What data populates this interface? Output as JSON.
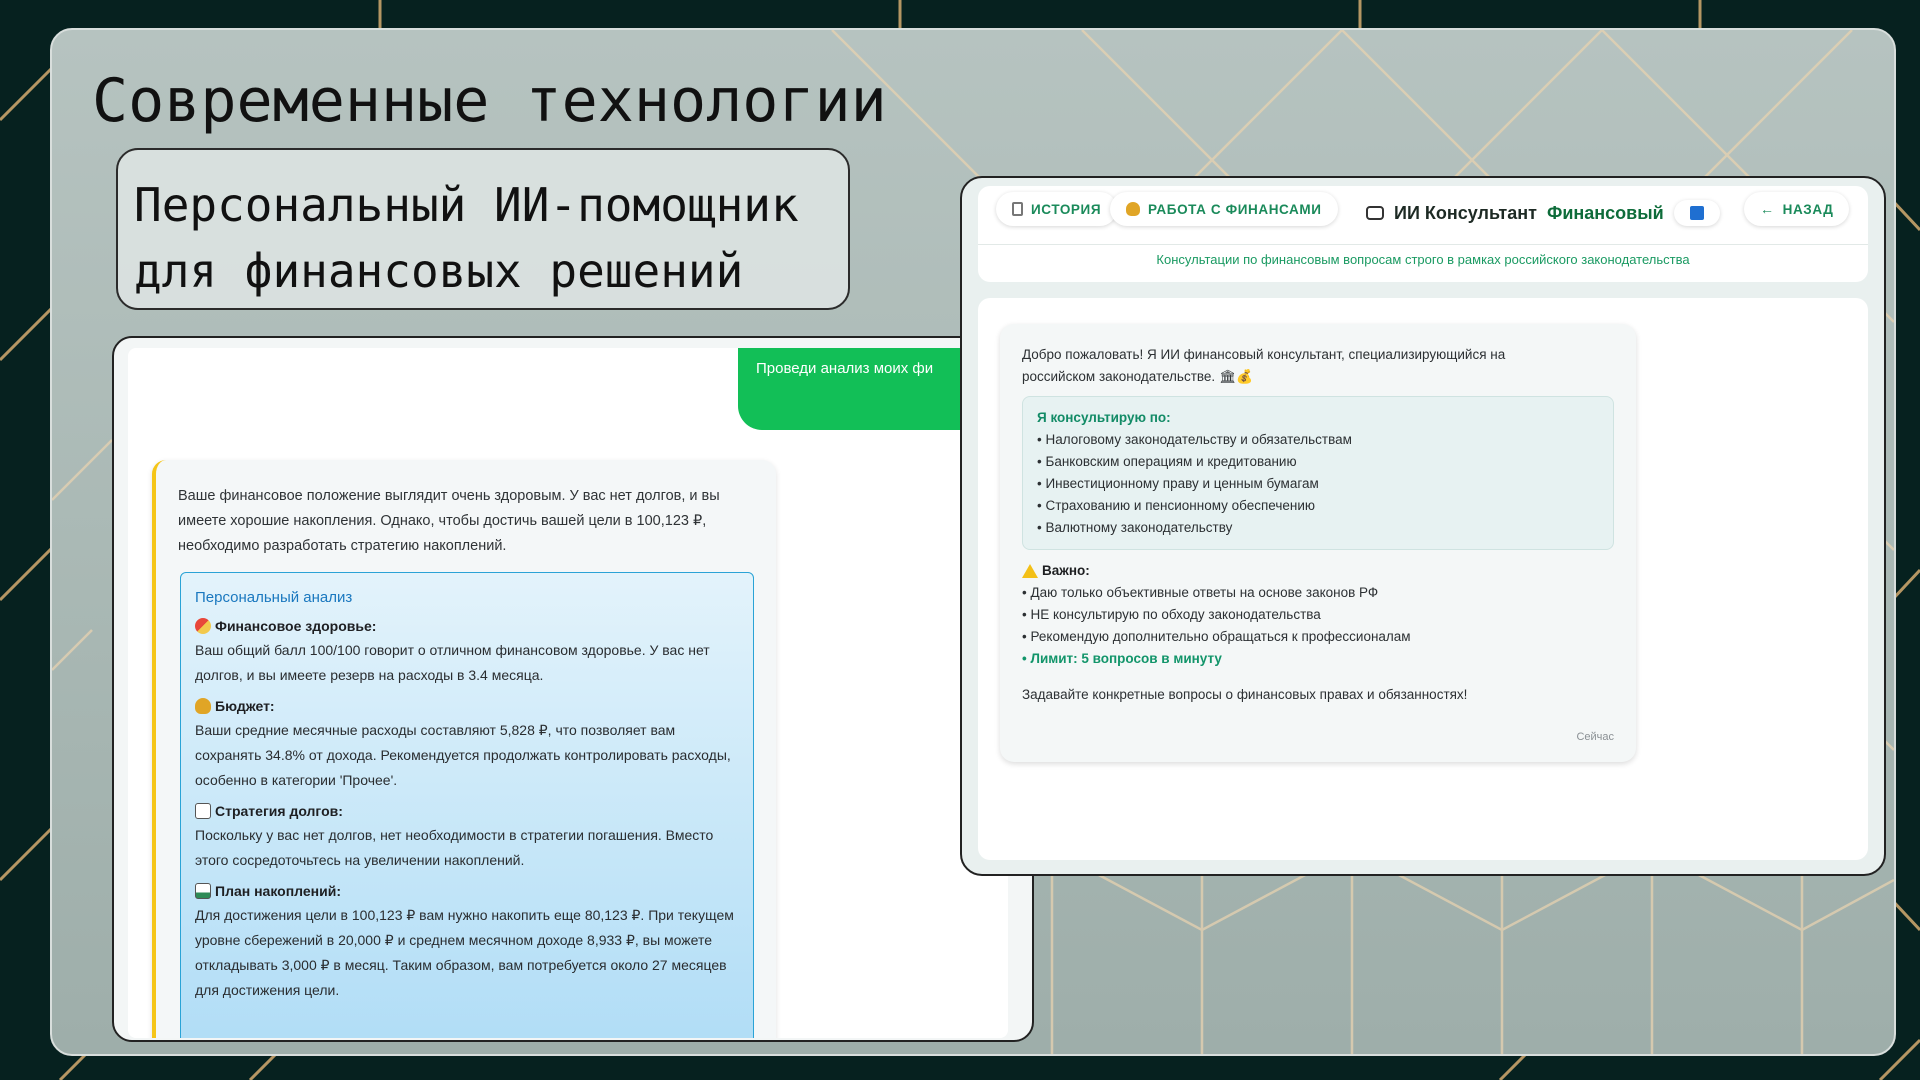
{
  "slide": {
    "title": "Современные технологии",
    "subtitle_line1": "Персональный ИИ-помощник",
    "subtitle_line2": "для финансовых решений"
  },
  "left_screenshot": {
    "user_message": "Проведи анализ моих фи",
    "ai_intro": "Ваше финансовое положение выглядит очень здоровым. У вас нет долгов, и вы имеете хорошие накопления. Однако, чтобы достичь вашей цели в 100,123 ₽, необходимо разработать стратегию накоплений.",
    "analysis_title": "Персональный анализ",
    "sections": [
      {
        "icon": "pill-icon",
        "title": "Финансовое здоровье:",
        "text": "Ваш общий балл 100/100 говорит о отличном финансовом здоровье. У вас нет долгов, и вы имеете резерв на расходы в 3.4 месяца."
      },
      {
        "icon": "money-bag-icon",
        "title": "Бюджет:",
        "text": "Ваши средние месячные расходы составляют 5,828 ₽, что позволяет вам сохранять 34.8% от дохода. Рекомендуется продолжать контролировать расходы, особенно в категории 'Прочее'."
      },
      {
        "icon": "chart-down-icon",
        "title": "Стратегия долгов:",
        "text": "Поскольку у вас нет долгов, нет необходимости в стратегии погашения. Вместо этого сосредоточьтесь на увеличении накоплений."
      },
      {
        "icon": "chart-up-icon",
        "title": "План накоплений:",
        "text": "Для достижения цели в 100,123 ₽ вам нужно накопить еще 80,123 ₽. При текущем уровне сбережений в 20,000 ₽ и среднем месячном доходе 8,933 ₽, вы можете откладывать 3,000 ₽ в месяц. Таким образом, вам потребуется около 27 месяцев для достижения цели."
      }
    ]
  },
  "right_screenshot": {
    "history_label": "ИСТОРИЯ",
    "finance_label": "РАБОТА С ФИНАНСАМИ",
    "consultant_title": "ИИ Консультант",
    "consultant_title_accent": "Финансовый",
    "back_label": "НАЗАД",
    "subtitle": "Консультации по финансовым вопросам строго в рамках российского законодательства",
    "welcome_line1": "Добро пожаловать! Я ИИ финансовый консультант, специализирующийся на",
    "welcome_line2": "российском законодательстве. 🏛💰",
    "consult_title": "Я консультирую по:",
    "consult_items": [
      "• Налоговому законодательству и обязательствам",
      "• Банковским операциям и кредитованию",
      "• Инвестиционному праву и ценным бумагам",
      "• Страхованию и пенсионному обеспечению",
      "• Валютному законодательству"
    ],
    "important_title": "Важно:",
    "important_items": [
      "• Даю только объективные ответы на основе законов РФ",
      "• НЕ консультирую по обходу законодательства",
      "• Рекомендую дополнительно обращаться к профессионалам"
    ],
    "limit_text": "• Лимит: 5 вопросов в минуту",
    "closing": "Задавайте конкретные вопросы о финансовых правах и обязанностях!",
    "timestamp": "Сейчас"
  }
}
